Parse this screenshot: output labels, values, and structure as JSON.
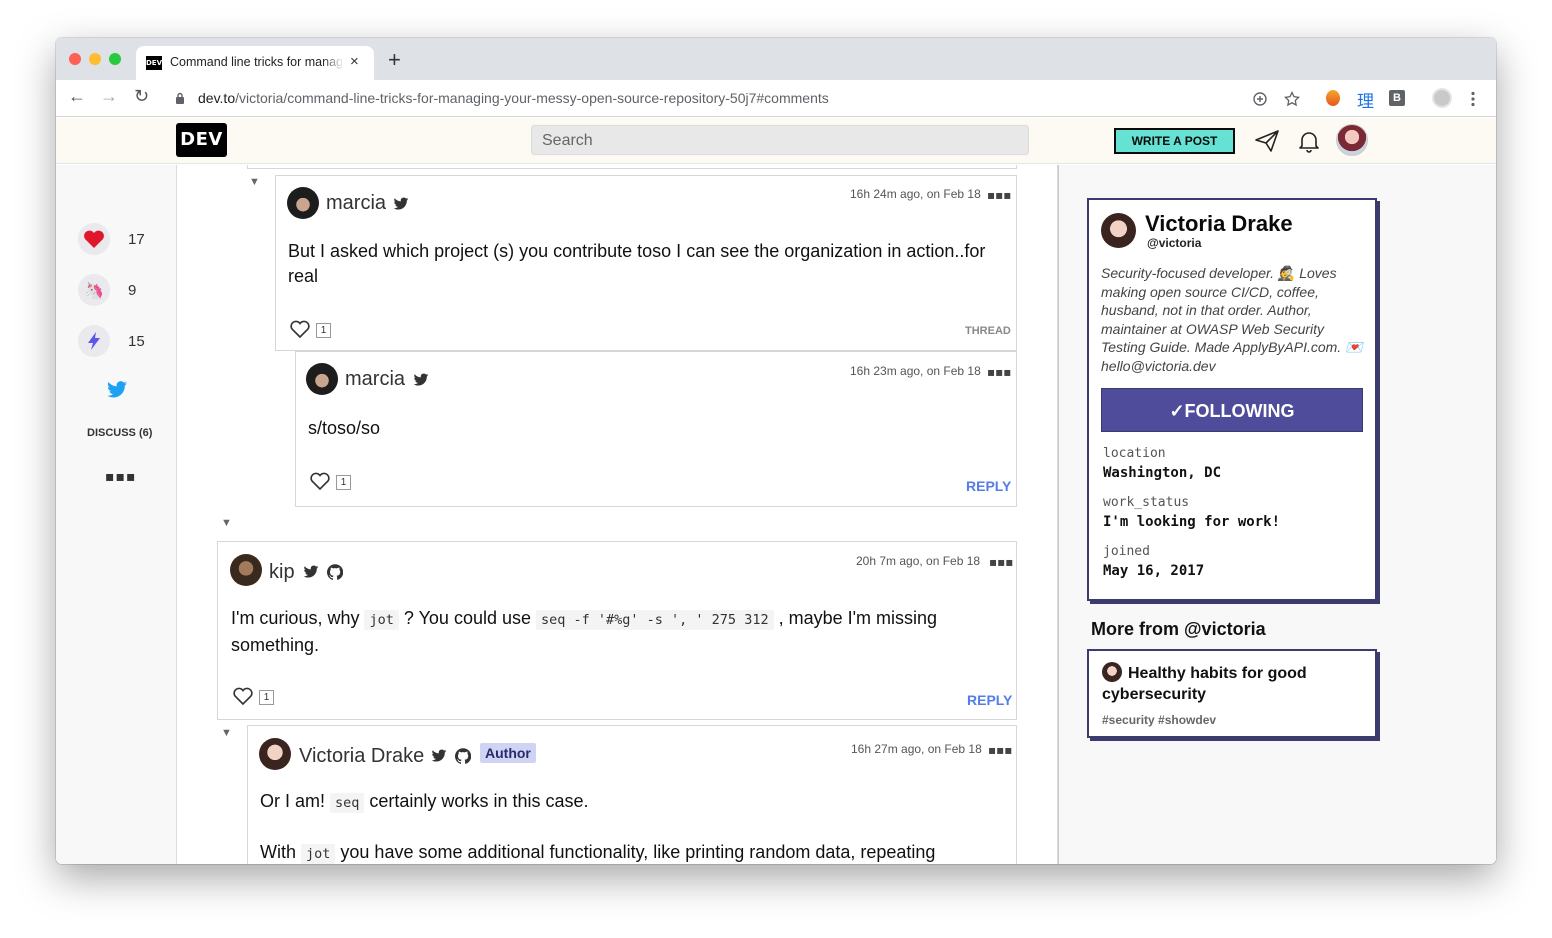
{
  "browser": {
    "tab_title": "Command line tricks for managing your messy open source repository",
    "tab_close": "×",
    "new_tab": "+",
    "url_host": "dev.to",
    "url_path": "/victoria/command-line-tricks-for-managing-your-messy-open-source-repository-50j7#comments",
    "back": "←",
    "forward": "→",
    "reload": "↻",
    "ext_kanji": "理",
    "ext_b": "B"
  },
  "header": {
    "logo": "DEV",
    "search_placeholder": "Search",
    "write_post": "WRITE A POST"
  },
  "reactions": {
    "hearts": "17",
    "unicorns": "9",
    "bookmarks": "15",
    "discuss": "DISCUSS (6)",
    "more": "▪▪▪"
  },
  "comments": [
    {
      "author": "marcia",
      "time": "16h 24m ago, on Feb 18",
      "text": "But I asked which project (s) you contribute toso I can see the organization in action..for real",
      "likes": "1",
      "action": "THREAD"
    },
    {
      "author": "marcia",
      "time": "16h 23m ago, on Feb 18",
      "text": "s/toso/so",
      "likes": "1",
      "action": "REPLY"
    },
    {
      "author": "kip",
      "time": "20h 7m ago, on Feb 18",
      "text_a": "I'm curious, why ",
      "code_a": "jot",
      "text_b": " ? You could use ",
      "code_b": "seq -f '#%g' -s ', ' 275 312",
      "text_c": " , maybe I'm missing something.",
      "likes": "1",
      "action": "REPLY"
    },
    {
      "author": "Victoria Drake",
      "badge": "Author",
      "time": "16h 27m ago, on Feb 18",
      "p1_a": "Or I am! ",
      "p1_code": "seq",
      "p1_b": " certainly works in this case.",
      "p2_a": "With ",
      "p2_code": "jot",
      "p2_b": " you have some additional functionality, like printing random data, repeating"
    }
  ],
  "dots": "▪▪▪",
  "profile": {
    "name": "Victoria Drake",
    "handle": "@victoria",
    "bio": "Security-focused developer. 🕵️ Loves making open source CI/CD, coffee, husband, not in that order. Author, maintainer at OWASP Web Security Testing Guide. Made ApplyByAPI.com. 💌 hello@victoria.dev",
    "follow_label": "✓FOLLOWING",
    "location_key": "location",
    "location_val": "Washington, DC",
    "work_key": "work_status",
    "work_val": "I'm looking for work!",
    "joined_key": "joined",
    "joined_val": "May 16, 2017"
  },
  "more_from": {
    "heading": "More from @victoria",
    "post_title": "Healthy habits for good cybersecurity",
    "tags": "#security #showdev"
  },
  "colors": {
    "accent": "#4e4c9b",
    "write_btn": "#66e2d5",
    "reply_link": "#557de8"
  }
}
